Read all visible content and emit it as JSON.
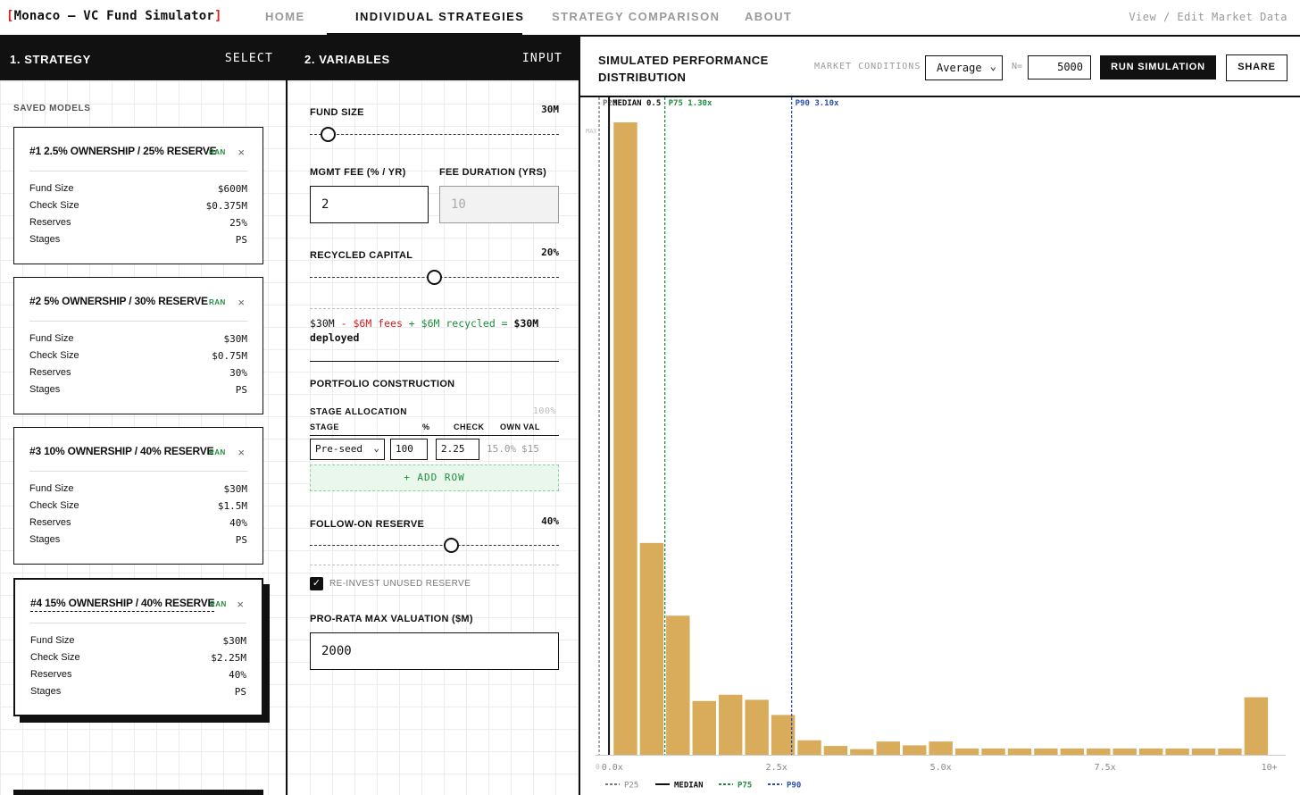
{
  "nav": {
    "brand_open": "[",
    "brand": "Monaco — VC Fund Simulator",
    "brand_close": "]",
    "tabs": [
      "HOME",
      "INDIVIDUAL STRATEGIES",
      "STRATEGY COMPARISON",
      "ABOUT"
    ],
    "active_tab": "INDIVIDUAL STRATEGIES",
    "market_link": "View / Edit Market Data"
  },
  "strategy_panel": {
    "title": "1. STRATEGY",
    "action": "SELECT",
    "saved_label": "SAVED MODELS",
    "models": [
      {
        "title": "#1 2.5% OWNERSHIP / 25% RESERVE",
        "badge": "RAN",
        "close": "×",
        "fund_size": "$600M",
        "check_size": "$0.375M",
        "reserves": "25%",
        "stages": "PS"
      },
      {
        "title": "#2 5% OWNERSHIP / 30% RESERVE",
        "badge": "RAN",
        "close": "×",
        "fund_size": "$30M",
        "check_size": "$0.75M",
        "reserves": "30%",
        "stages": "PS"
      },
      {
        "title": "#3 10% OWNERSHIP / 40% RESERVE",
        "badge": "RAN",
        "close": "×",
        "fund_size": "$30M",
        "check_size": "$1.5M",
        "reserves": "40%",
        "stages": "PS"
      },
      {
        "title": "#4 15% OWNERSHIP / 40% RESERVE",
        "badge": "RAN",
        "close": "×",
        "fund_size": "$30M",
        "check_size": "$2.25M",
        "reserves": "40%",
        "stages": "PS"
      }
    ],
    "row_labels": {
      "fund_size": "Fund Size",
      "check_size": "Check Size",
      "reserves": "Reserves",
      "stages": "Stages"
    },
    "selected_index": 3
  },
  "variables_panel": {
    "title": "2. VARIABLES",
    "action": "INPUT",
    "fund_size": {
      "label": "FUND SIZE",
      "value": "30M",
      "slider_fraction": 0.075
    },
    "mgmt_fee": {
      "label": "MGMT FEE (% / YR)",
      "value": "2"
    },
    "fee_duration": {
      "label": "FEE DURATION (YRS)",
      "placeholder": "10"
    },
    "recycled": {
      "label": "RECYCLED CAPITAL",
      "value": "20%",
      "slider_fraction": 0.5
    },
    "formula": {
      "base": "$30M",
      "minus": " - ",
      "fees": "$6M fees",
      "plus": " + ",
      "recycled": "$6M recycled",
      "eq": " = ",
      "result": "$30M",
      "suffix": "deployed"
    },
    "portfolio_heading": "PORTFOLIO CONSTRUCTION",
    "stage_allocation": {
      "label": "STAGE ALLOCATION",
      "total": "100%",
      "headers": {
        "stage": "STAGE",
        "pct": "%",
        "check": "CHECK",
        "own": "OWN",
        "val": "VAL"
      },
      "rows": [
        {
          "stage": "Pre-seed",
          "pct": "100",
          "check": "2.25",
          "own": "15.0%",
          "val": "$15"
        }
      ]
    },
    "add_row": "+ ADD ROW",
    "follow_on": {
      "label": "FOLLOW-ON RESERVE",
      "value": "40%",
      "slider_fraction": 0.57
    },
    "reinvest": {
      "label": "RE-INVEST UNUSED RESERVE",
      "checked": "✓"
    },
    "pro_rata": {
      "label": "PRO-RATA MAX VALUATION ($M)",
      "value": "2000"
    }
  },
  "results_panel": {
    "title_line1": "SIMULATED PERFORMANCE",
    "title_line2": "DISTRIBUTION",
    "market_label": "MARKET CONDITIONS",
    "market_value": "Average",
    "n_label": "N=",
    "n_value": "5000",
    "run_button": "RUN SIMULATION",
    "share_button": "SHARE"
  },
  "colors": {
    "bar": "#d9ac5c",
    "p25": "#777777",
    "median": "#111111",
    "p75": "#1e8e3e",
    "p90": "#2a4fb0",
    "accent_red": "#d32020"
  },
  "chart_data": {
    "type": "bar",
    "title": "SIMULATED PERFORMANCE DISTRIBUTION",
    "x_bins_start": [
      0,
      0.4,
      0.8,
      1.2,
      1.6,
      2.0,
      2.4,
      2.8,
      3.2,
      3.6,
      4.0,
      4.4,
      4.8,
      5.2,
      5.6,
      6.0,
      6.4,
      6.8,
      7.2,
      7.6,
      8.0,
      8.4,
      8.8,
      9.2,
      9.6
    ],
    "bin_width": 0.4,
    "values": [
      100,
      33.5,
      22,
      8.5,
      9.5,
      8.7,
      6.3,
      2.3,
      1.4,
      0.9,
      2.1,
      1.5,
      2.1,
      1.0,
      1.0,
      1.0,
      1.0,
      1.0,
      1.0,
      1.0,
      1.0,
      1.0,
      1.0,
      1.0,
      9.1
    ],
    "x_ticks": [
      {
        "value": 0,
        "label": "0.0x"
      },
      {
        "value": 2.5,
        "label": "2.5x"
      },
      {
        "value": 5,
        "label": "5.0x"
      },
      {
        "value": 7.5,
        "label": "7.5x"
      },
      {
        "value": 10,
        "label": "10+"
      }
    ],
    "y_labels": {
      "top": "MAX",
      "bottom": "0"
    },
    "xlim": [
      -0.35,
      10.25
    ],
    "markers": [
      {
        "name": "P25",
        "value": -0.2,
        "label": "P25",
        "style": "dashed",
        "color": "#777777"
      },
      {
        "name": "MEDIAN",
        "value": -0.05,
        "label": "MEDIAN 0.5",
        "style": "solid",
        "color": "#111111"
      },
      {
        "name": "P75",
        "value": 0.8,
        "label": "P75 1.30x",
        "style": "dashed",
        "color": "#1e8e3e"
      },
      {
        "name": "P90",
        "value": 2.73,
        "label": "P90 3.10x",
        "style": "dashed",
        "color": "#2a4fb0"
      }
    ],
    "legend": [
      {
        "label": "P25",
        "color": "#777777",
        "style": "dashed"
      },
      {
        "label": "MEDIAN",
        "color": "#111111",
        "style": "solid"
      },
      {
        "label": "P75",
        "color": "#1e8e3e",
        "style": "dashed"
      },
      {
        "label": "P90",
        "color": "#2a4fb0",
        "style": "dashed"
      }
    ],
    "legend_placement": "bottom-left"
  }
}
